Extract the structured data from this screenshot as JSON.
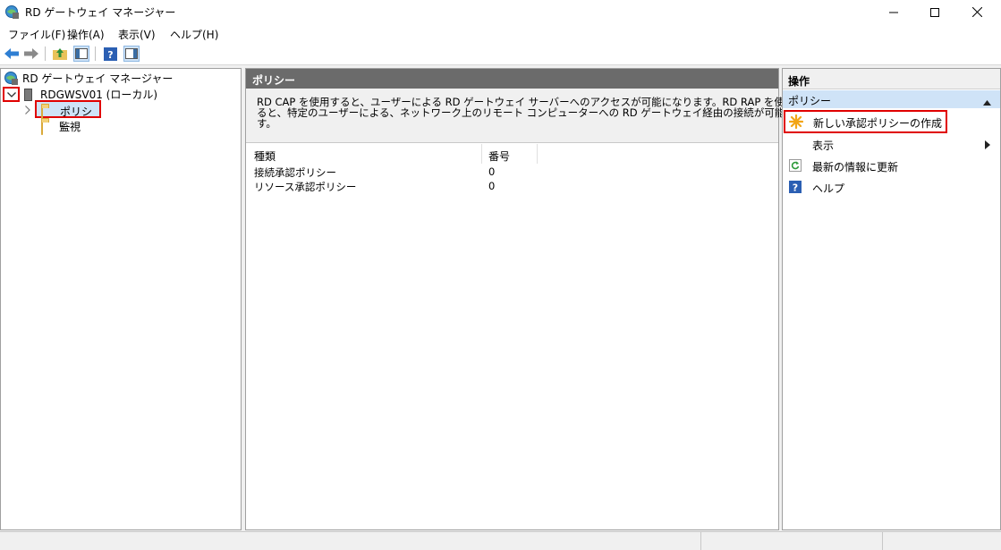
{
  "window": {
    "title": "RD ゲートウェイ マネージャー"
  },
  "menu": {
    "items": [
      "ファイル(F)",
      "操作(A)",
      "表示(V)",
      "ヘルプ(H)"
    ]
  },
  "toolbar": {
    "icons": [
      "back-arrow-icon",
      "forward-arrow-icon",
      "up-folder-icon",
      "show-hide-tree-icon",
      "help-icon",
      "show-hide-action-pane-icon"
    ]
  },
  "tree": {
    "root": "RD ゲートウェイ マネージャー",
    "server": "RDGWSV01 (ローカル)",
    "children": [
      "ポリシー",
      "監視"
    ]
  },
  "center": {
    "header": "ポリシー",
    "description_line1": "RD CAP を使用すると、ユーザーによる RD ゲートウェイ サーバーへのアクセスが可能になります。RD RAP を使用す",
    "description_line2": "ると、特定のユーザーによる、ネットワーク上のリモート コンピューターへの RD ゲートウェイ経由の接続が可能になりま",
    "description_line3": "す。",
    "columns": [
      "種類",
      "番号"
    ],
    "rows": [
      {
        "type": "接続承認ポリシー",
        "count": "0"
      },
      {
        "type": "リソース承認ポリシー",
        "count": "0"
      }
    ]
  },
  "actions": {
    "title": "操作",
    "section": "ポリシー",
    "items": [
      {
        "label": "新しい承認ポリシーの作成",
        "icon": "new-policy-star-icon"
      },
      {
        "label": "表示",
        "icon": "none"
      },
      {
        "label": "最新の情報に更新",
        "icon": "refresh-icon"
      },
      {
        "label": "ヘルプ",
        "icon": "help-icon"
      }
    ]
  },
  "colors": {
    "highlight_box": "#e00000",
    "center_header_bg": "#6b6b6b",
    "section_bg": "#cfe3f7",
    "folder": "#f3d27a"
  }
}
